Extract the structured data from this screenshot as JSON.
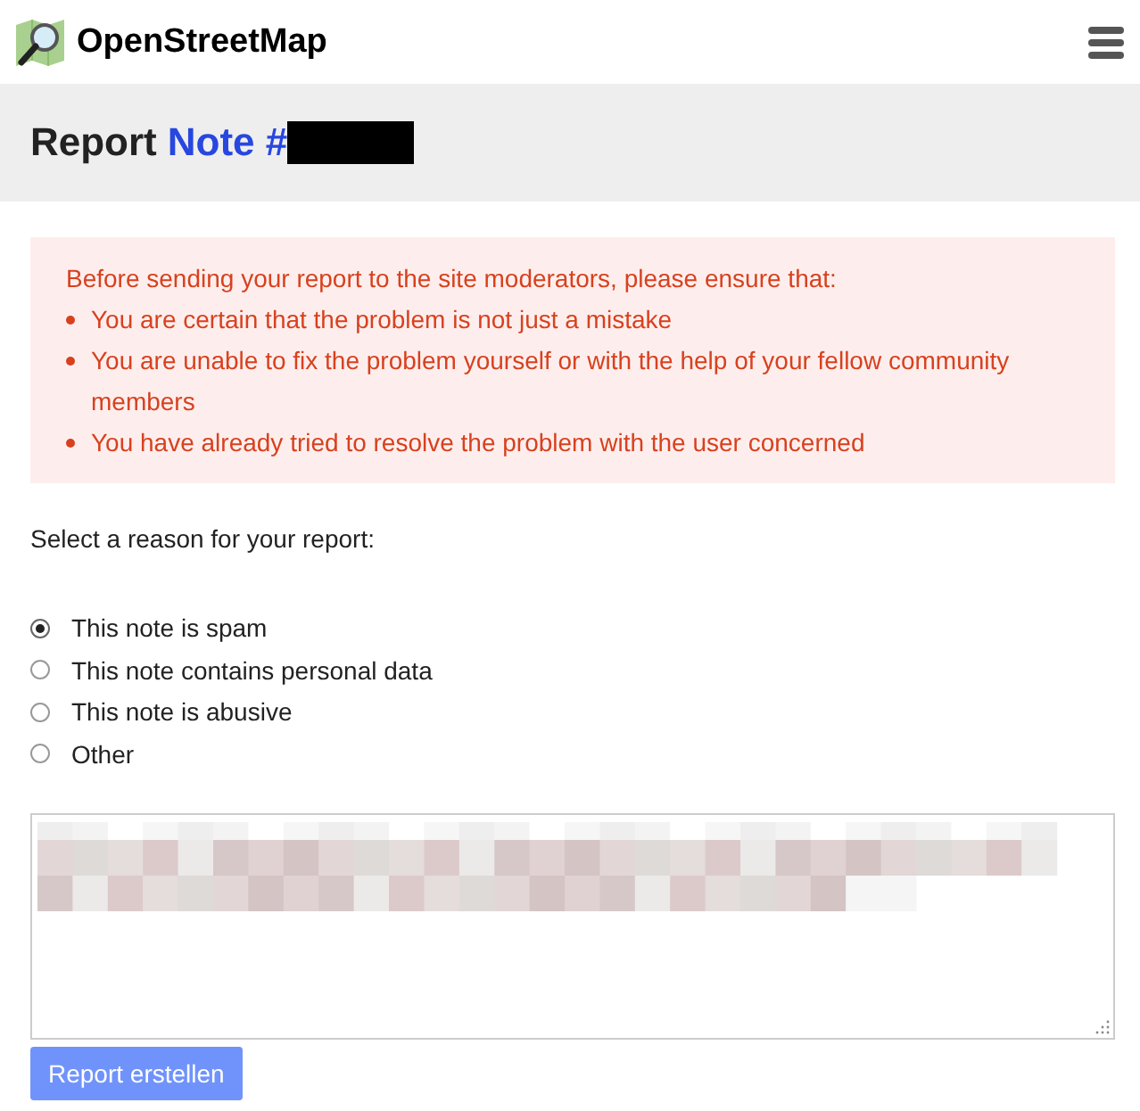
{
  "header": {
    "site_name": "OpenStreetMap"
  },
  "page_title": {
    "prefix": "Report",
    "link": "Note #",
    "redacted": true
  },
  "notice": {
    "intro": "Before sending your report to the site moderators, please ensure that:",
    "items": [
      "You are certain that the problem is not just a mistake",
      "You are unable to fix the problem yourself or with the help of your fellow community members",
      "You have already tried to resolve the problem with the user concerned"
    ]
  },
  "reason_label": "Select a reason for your report:",
  "reasons": [
    {
      "label": "This note is spam",
      "selected": true
    },
    {
      "label": "This note contains personal data",
      "selected": false
    },
    {
      "label": "This note is abusive",
      "selected": false
    },
    {
      "label": "Other",
      "selected": false
    }
  ],
  "submit": {
    "label": "Report erstellen",
    "disabled": true
  }
}
